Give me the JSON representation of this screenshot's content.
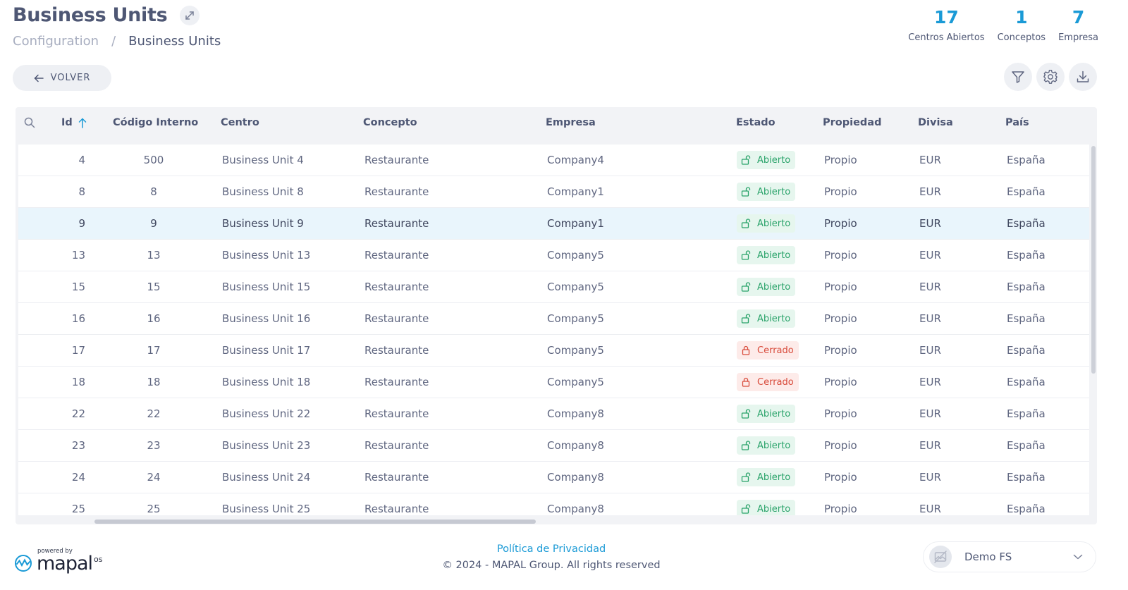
{
  "header": {
    "title": "Business Units",
    "breadcrumb": {
      "parent": "Configuration",
      "separator": "/",
      "current": "Business Units"
    },
    "stats": [
      {
        "value": "17",
        "label": "Centros Abiertos"
      },
      {
        "value": "1",
        "label": "Conceptos"
      },
      {
        "value": "7",
        "label": "Empresa"
      }
    ]
  },
  "toolbar": {
    "back_label": "VOLVER"
  },
  "table": {
    "columns": {
      "id": "Id",
      "codigo": "Código Interno",
      "centro": "Centro",
      "concepto": "Concepto",
      "empresa": "Empresa",
      "estado": "Estado",
      "propiedad": "Propiedad",
      "divisa": "Divisa",
      "pais": "País"
    },
    "rows": [
      {
        "id": "4",
        "codigo": "500",
        "centro": "Business Unit 4",
        "concepto": "Restaurante",
        "empresa": "Company4",
        "estado": "Abierto",
        "propiedad": "Propio",
        "divisa": "EUR",
        "pais": "España"
      },
      {
        "id": "8",
        "codigo": "8",
        "centro": "Business Unit 8",
        "concepto": "Restaurante",
        "empresa": "Company1",
        "estado": "Abierto",
        "propiedad": "Propio",
        "divisa": "EUR",
        "pais": "España"
      },
      {
        "id": "9",
        "codigo": "9",
        "centro": "Business Unit 9",
        "concepto": "Restaurante",
        "empresa": "Company1",
        "estado": "Abierto",
        "propiedad": "Propio",
        "divisa": "EUR",
        "pais": "España"
      },
      {
        "id": "13",
        "codigo": "13",
        "centro": "Business Unit 13",
        "concepto": "Restaurante",
        "empresa": "Company5",
        "estado": "Abierto",
        "propiedad": "Propio",
        "divisa": "EUR",
        "pais": "España"
      },
      {
        "id": "15",
        "codigo": "15",
        "centro": "Business Unit 15",
        "concepto": "Restaurante",
        "empresa": "Company5",
        "estado": "Abierto",
        "propiedad": "Propio",
        "divisa": "EUR",
        "pais": "España"
      },
      {
        "id": "16",
        "codigo": "16",
        "centro": "Business Unit 16",
        "concepto": "Restaurante",
        "empresa": "Company5",
        "estado": "Abierto",
        "propiedad": "Propio",
        "divisa": "EUR",
        "pais": "España"
      },
      {
        "id": "17",
        "codigo": "17",
        "centro": "Business Unit 17",
        "concepto": "Restaurante",
        "empresa": "Company5",
        "estado": "Cerrado",
        "propiedad": "Propio",
        "divisa": "EUR",
        "pais": "España"
      },
      {
        "id": "18",
        "codigo": "18",
        "centro": "Business Unit 18",
        "concepto": "Restaurante",
        "empresa": "Company5",
        "estado": "Cerrado",
        "propiedad": "Propio",
        "divisa": "EUR",
        "pais": "España"
      },
      {
        "id": "22",
        "codigo": "22",
        "centro": "Business Unit 22",
        "concepto": "Restaurante",
        "empresa": "Company8",
        "estado": "Abierto",
        "propiedad": "Propio",
        "divisa": "EUR",
        "pais": "España"
      },
      {
        "id": "23",
        "codigo": "23",
        "centro": "Business Unit 23",
        "concepto": "Restaurante",
        "empresa": "Company8",
        "estado": "Abierto",
        "propiedad": "Propio",
        "divisa": "EUR",
        "pais": "España"
      },
      {
        "id": "24",
        "codigo": "24",
        "centro": "Business Unit 24",
        "concepto": "Restaurante",
        "empresa": "Company8",
        "estado": "Abierto",
        "propiedad": "Propio",
        "divisa": "EUR",
        "pais": "España"
      },
      {
        "id": "25",
        "codigo": "25",
        "centro": "Business Unit 25",
        "concepto": "Restaurante",
        "empresa": "Company8",
        "estado": "Abierto",
        "propiedad": "Propio",
        "divisa": "EUR",
        "pais": "España"
      }
    ],
    "selected_row": "9"
  },
  "footer": {
    "powered_by": "powered by",
    "brand": "mapal",
    "brand_suffix": "os",
    "privacy_link": "Política de Privacidad",
    "copyright": "© 2024 - MAPAL Group. All rights reserved",
    "user": "Demo FS"
  },
  "icons": {
    "expand": "expand-icon",
    "back": "arrow-left-icon",
    "filter": "filter-icon",
    "settings": "gear-icon",
    "download": "download-icon",
    "search": "search-icon",
    "sort": "arrow-up-icon",
    "open": "unlock-icon",
    "closed": "lock-icon",
    "chevron": "chevron-down-icon"
  },
  "colors": {
    "accent": "#1a9ad6",
    "open_text": "#2aa36a",
    "open_bg": "#e6f6ee",
    "closed_text": "#d84a3a",
    "closed_bg": "#fdebe9",
    "selected_row": "#e9f5fc"
  }
}
